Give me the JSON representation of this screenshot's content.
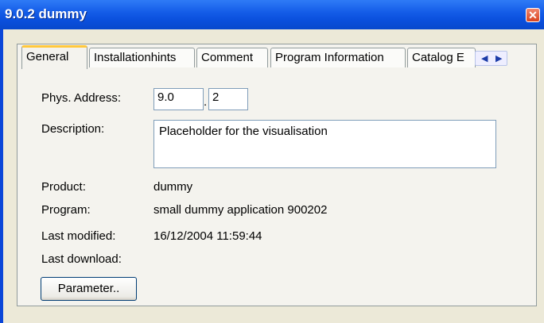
{
  "window": {
    "title": "9.0.2 dummy",
    "close_glyph": "✕"
  },
  "tabs": [
    {
      "label": "General",
      "active": true
    },
    {
      "label": "Installationhints",
      "active": false
    },
    {
      "label": "Comment",
      "active": false
    },
    {
      "label": "Program Information",
      "active": false
    },
    {
      "label": "Catalog E",
      "active": false
    }
  ],
  "tab_scroll": {
    "left_icon": "chevron-left-icon",
    "right_icon": "chevron-right-icon"
  },
  "general": {
    "phys_address_label": "Phys. Address:",
    "phys_address_part1": "9.0",
    "phys_address_separator": ".",
    "phys_address_part2": "2",
    "description_label": "Description:",
    "description_value": "Placeholder for the visualisation",
    "product_label": "Product:",
    "product_value": "dummy",
    "program_label": "Program:",
    "program_value": "small dummy application 900202",
    "last_modified_label": "Last modified:",
    "last_modified_value": "16/12/2004 11:59:44",
    "last_download_label": "Last download:",
    "last_download_value": "",
    "parameter_button": "Parameter.."
  },
  "colors": {
    "titlebar": "#0a4fdc",
    "close_button": "#d9441f",
    "active_tab_accent": "#ffc83c",
    "panel_bg": "#f4f3ee"
  }
}
